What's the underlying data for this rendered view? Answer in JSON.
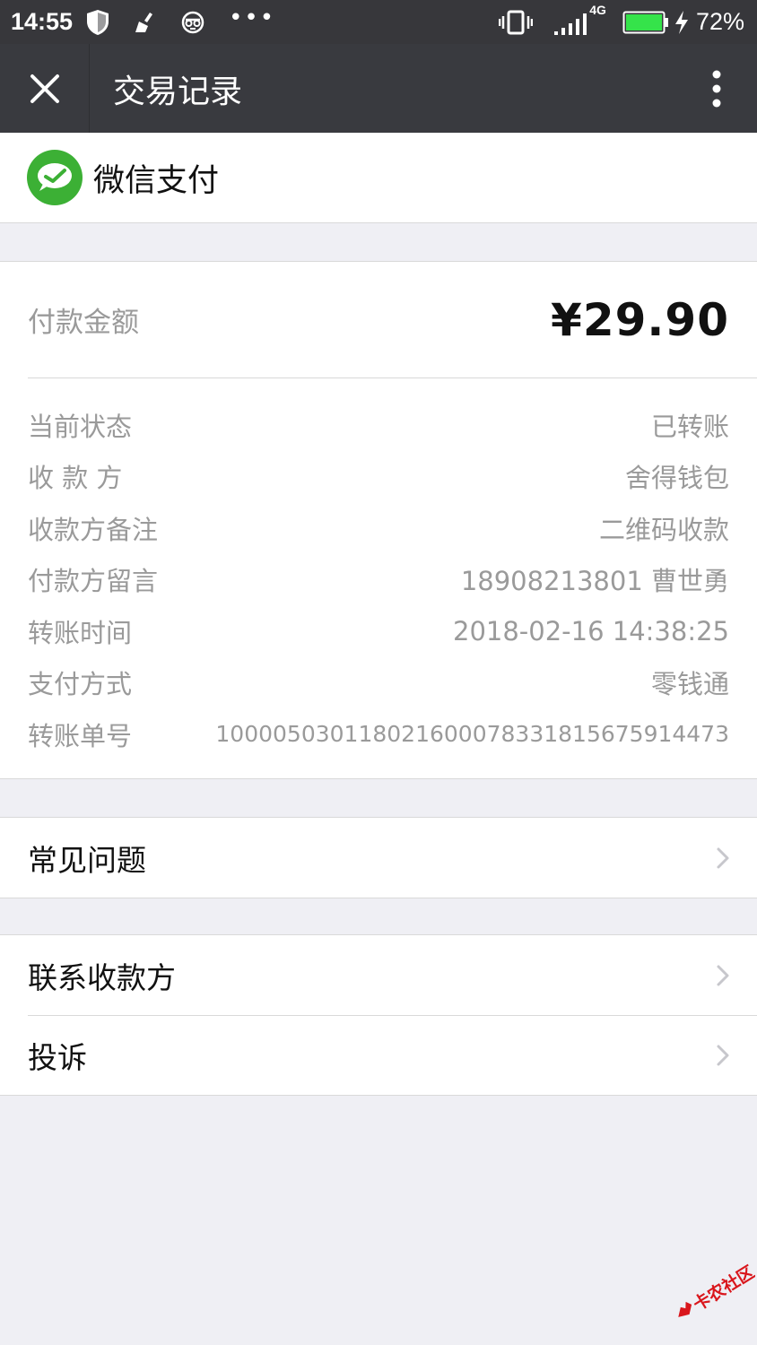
{
  "status_bar": {
    "time": "14:55",
    "network": "4G",
    "battery_percent": "72%",
    "icons": [
      "shield-icon",
      "broom-icon",
      "incognito-icon",
      "more-dots-icon",
      "vibrate-icon",
      "signal-icon",
      "battery-icon",
      "charging-icon"
    ]
  },
  "nav": {
    "title": "交易记录",
    "close_icon": "close-icon",
    "more_icon": "more-vertical-icon"
  },
  "brand": {
    "name": "微信支付",
    "color": "#3cb035"
  },
  "payment": {
    "amount_label": "付款金额",
    "amount_value": "¥29.90",
    "details": [
      {
        "label": "当前状态",
        "value": "已转账"
      },
      {
        "label": "收 款 方",
        "value": "舍得钱包"
      },
      {
        "label": "收款方备注",
        "value": "二维码收款"
      },
      {
        "label": "付款方留言",
        "value": "18908213801 曹世勇"
      },
      {
        "label": "转账时间",
        "value": "2018-02-16 14:38:25"
      },
      {
        "label": "支付方式",
        "value": "零钱通"
      },
      {
        "label": "转账单号",
        "value": "100005030118021600078331815675914473"
      }
    ]
  },
  "actions": {
    "faq": "常见问题",
    "contact_payee": "联系收款方",
    "complain": "投诉"
  },
  "watermark": {
    "text": "卡农社区",
    "color": "#d9161c"
  }
}
